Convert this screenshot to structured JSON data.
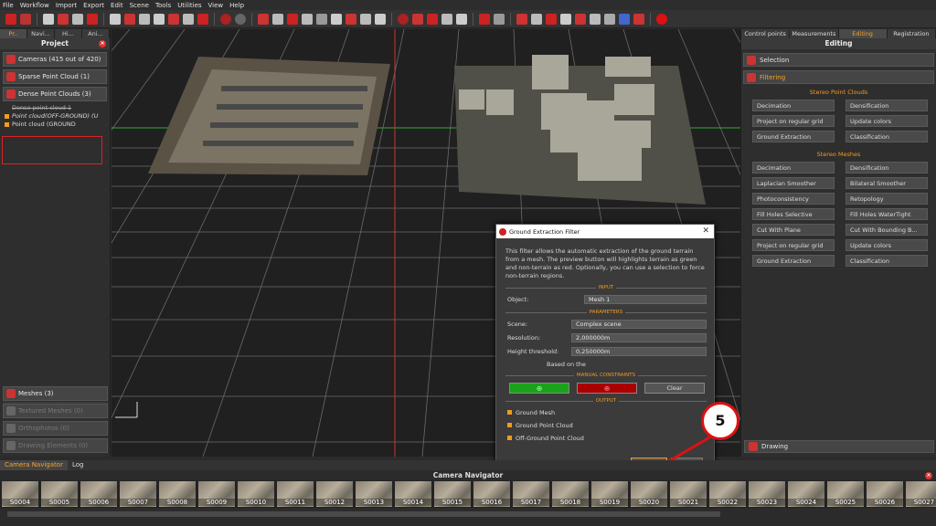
{
  "menu": [
    "File",
    "Workflow",
    "Import",
    "Export",
    "Edit",
    "Scene",
    "Tools",
    "Utilities",
    "View",
    "Help"
  ],
  "left_panel": {
    "tabs": [
      "Pr..",
      "Navi...",
      "Hi...",
      "Ani..."
    ],
    "title": "Project",
    "cameras": "Cameras (415 out of 420)",
    "sparse": "Sparse Point Cloud (1)",
    "dense": "Dense Point Clouds (3)",
    "dense_items": [
      "Dense point cloud 1",
      "Point cloud(OFF-GROUND) (U",
      "Point cloud (GROUND"
    ],
    "meshes": "Meshes (3)",
    "textured": "Textured Meshes (0)",
    "orthophotos": "Orthophotos (0)",
    "drawing": "Drawing Elements (0)"
  },
  "dialog": {
    "title": "Ground Extraction Filter",
    "description": "This filter allows the automatic extraction of the ground terrain from a mesh. The preview button will highlights terrain as green and non-terrain as red. Optionally, you can use a selection to force non-terrain regions.",
    "input_section": "INPUT",
    "object_label": "Object:",
    "object_value": "Mesh 1",
    "params_section": "PARAMETERS",
    "scene_label": "Scene:",
    "scene_value": "Complex scene",
    "resolution_label": "Resolution:",
    "resolution_value": "2,000000m",
    "height_label": "Height threshold:",
    "height_value": "0,250000m",
    "based_on": "Based on the",
    "manual_section": "MANUAL CONSTRAINTS",
    "clear_label": "Clear",
    "output_section": "OUTPUT",
    "outputs": [
      "Ground Mesh",
      "Ground Point Cloud",
      "Off-Ground Point Cloud"
    ],
    "compute_label": "Compute",
    "preview_label": "Preview"
  },
  "callout": "5",
  "right_panel": {
    "tabs": [
      "Control points",
      "Measurements",
      "Editing",
      "Registration"
    ],
    "title": "Editing",
    "selection": "Selection",
    "filtering": "Filtering",
    "stereo_pc_section": "Stereo Point Clouds",
    "stereo_pc_buttons": [
      "Decimation",
      "Densification",
      "Project on regular grid",
      "Update colors",
      "Ground Extraction",
      "Classification"
    ],
    "stereo_mesh_section": "Stereo Meshes",
    "stereo_mesh_buttons": [
      "Decimation",
      "Densification",
      "Laplacian Smoother",
      "Bilateral Smoother",
      "Photoconsistency",
      "Retopology",
      "Fill Holes Selective",
      "Fill Holes WaterTight",
      "Cut With Plane",
      "Cut With Bounding B...",
      "Project on regular grid",
      "Update colors",
      "Ground Extraction",
      "Classification"
    ],
    "drawing": "Drawing"
  },
  "bottom": {
    "tabs": [
      "Camera Navigator",
      "Log"
    ],
    "title": "Camera Navigator",
    "thumbnails": [
      "S0004",
      "S0005",
      "S0006",
      "S0007",
      "S0008",
      "S0009",
      "S0010",
      "S0011",
      "S0012",
      "S0013",
      "S0014",
      "S0015",
      "S0016",
      "S0017",
      "S0018",
      "S0019",
      "S0020",
      "S0021",
      "S0022",
      "S0023",
      "S0024",
      "S0025",
      "S0026",
      "S0027"
    ]
  },
  "colors": {
    "accent": "#f29b1f",
    "brand_red": "#cc2222",
    "preview_green": "#1aa31a",
    "preview_red": "#aa0000"
  }
}
